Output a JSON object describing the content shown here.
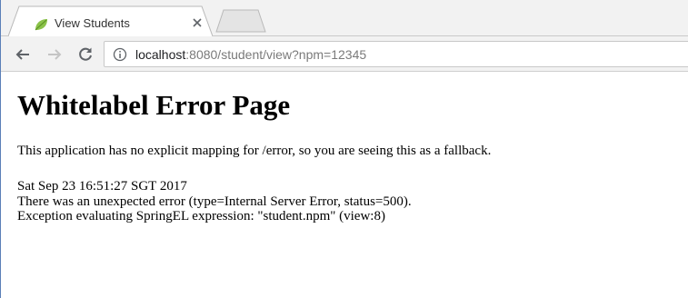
{
  "browser": {
    "tab": {
      "title": "View Students",
      "favicon": "leaf-icon",
      "close": "close-icon"
    },
    "toolbar": {
      "back": "back-arrow-icon",
      "forward": "forward-arrow-icon",
      "reload": "reload-icon",
      "site_info": "info-icon",
      "url_host": "localhost",
      "url_rest": ":8080/student/view?npm=12345"
    },
    "colors": {
      "frame": "#f2f2f2",
      "favicon": "#8bc34a",
      "window_border": "#5b7fb8"
    }
  },
  "page": {
    "heading": "Whitelabel Error Page",
    "message": "This application has no explicit mapping for /error, so you are seeing this as a fallback.",
    "error_lines": [
      "Sat Sep 23 16:51:27 SGT 2017",
      "There was an unexpected error (type=Internal Server Error, status=500).",
      "Exception evaluating SpringEL expression: \"student.npm\" (view:8)"
    ]
  }
}
